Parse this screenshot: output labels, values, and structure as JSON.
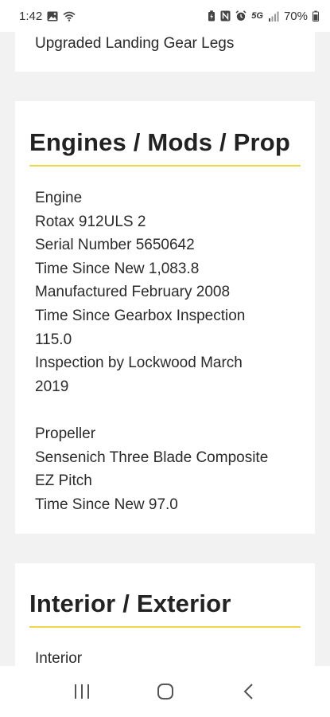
{
  "status_bar": {
    "time": "1:42",
    "network": "5G",
    "battery": "70%"
  },
  "top_card": {
    "text": "Upgraded Landing Gear Legs"
  },
  "engines_section": {
    "heading": "Engines / Mods / Prop",
    "engine_lines": [
      "Engine",
      "Rotax 912ULS 2",
      "Serial Number 5650642",
      "Time Since New 1,083.8",
      "Manufactured February 2008",
      "Time Since Gearbox Inspection",
      "115.0",
      "Inspection by Lockwood March",
      "2019"
    ],
    "propeller_lines": [
      "Propeller",
      "Sensenich Three Blade Composite",
      "EZ Pitch",
      "Time Since New 97.0"
    ]
  },
  "interior_section": {
    "heading": "Interior / Exterior",
    "lines": [
      "Interior"
    ]
  },
  "colors": {
    "accent_rule": "#f1d54a",
    "page_background": "#f2f2f2",
    "card_background": "#ffffff"
  }
}
